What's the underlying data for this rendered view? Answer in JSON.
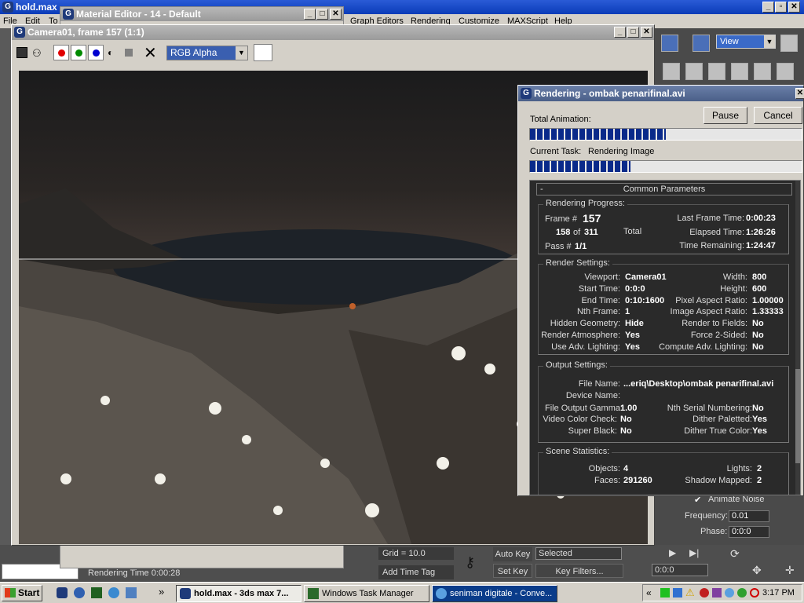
{
  "desktop": {
    "max_title": "hold.max",
    "menu_items": [
      "File",
      "Edit",
      "To",
      "Graph Editors",
      "Rendering",
      "Customize",
      "MAXScript",
      "Help"
    ],
    "view_select": "View"
  },
  "material_editor": {
    "title": "Material Editor - 14 - Default"
  },
  "frame_window": {
    "title": "Camera01, frame 157 (1:1)",
    "channel_select": "RGB Alpha"
  },
  "rendering_dialog": {
    "title": "Rendering - ombak penarifinal.avi",
    "pause_label": "Pause",
    "cancel_label": "Cancel",
    "total_animation_label": "Total Animation:",
    "total_progress": 0.5,
    "current_task_label": "Current Task:",
    "current_task_value": "Rendering Image",
    "task_progress": 0.37,
    "rollout_toggle": "-",
    "rollout_title": "Common Parameters",
    "progress": {
      "title": "Rendering Progress:",
      "frame_label": "Frame #",
      "frame_value": "157",
      "frames_done": "158",
      "of_label": "of",
      "frames_total": "311",
      "total_label": "Total",
      "pass_label": "Pass #",
      "pass_value": "1/1",
      "last_frame_label": "Last Frame Time:",
      "last_frame_value": "0:00:23",
      "elapsed_label": "Elapsed Time:",
      "elapsed_value": "1:26:26",
      "remaining_label": "Time Remaining:",
      "remaining_value": "1:24:47"
    },
    "render_settings": {
      "title": "Render Settings:",
      "left": [
        {
          "label": "Viewport:",
          "value": "Camera01"
        },
        {
          "label": "Start Time:",
          "value": "0:0:0"
        },
        {
          "label": "End Time:",
          "value": "0:10:1600"
        },
        {
          "label": "Nth Frame:",
          "value": "1"
        },
        {
          "label": "Hidden Geometry:",
          "value": "Hide"
        },
        {
          "label": "Render Atmosphere:",
          "value": "Yes"
        },
        {
          "label": "Use Adv. Lighting:",
          "value": "Yes"
        }
      ],
      "right": [
        {
          "label": "Width:",
          "value": "800"
        },
        {
          "label": "Height:",
          "value": "600"
        },
        {
          "label": "Pixel Aspect Ratio:",
          "value": "1.00000"
        },
        {
          "label": "Image Aspect Ratio:",
          "value": "1.33333"
        },
        {
          "label": "Render to Fields:",
          "value": "No"
        },
        {
          "label": "Force 2-Sided:",
          "value": "No"
        },
        {
          "label": "Compute Adv. Lighting:",
          "value": "No"
        }
      ]
    },
    "output_settings": {
      "title": "Output Settings:",
      "file_name_label": "File Name:",
      "file_name_value": "...eriq\\Desktop\\ombak penarifinal.avi",
      "device_name_label": "Device Name:",
      "gamma_label": "File Output Gamma:",
      "gamma_value": "1.00",
      "nth_serial_label": "Nth Serial Numbering:",
      "nth_serial_value": "No",
      "video_check_label": "Video Color Check:",
      "video_check_value": "No",
      "dither_pal_label": "Dither Paletted:",
      "dither_pal_value": "Yes",
      "super_black_label": "Super Black:",
      "super_black_value": "No",
      "dither_true_label": "Dither True Color:",
      "dither_true_value": "Yes"
    },
    "scene_stats": {
      "title": "Scene Statistics:",
      "objects_label": "Objects:",
      "objects_value": "4",
      "lights_label": "Lights:",
      "lights_value": "2",
      "faces_label": "Faces:",
      "faces_value": "291260",
      "shadow_label": "Shadow Mapped:",
      "shadow_value": "2"
    }
  },
  "side_panel": {
    "animate_noise_label": "Animate Noise",
    "frequency_label": "Frequency:",
    "frequency_value": "0.01",
    "phase_label": "Phase:",
    "phase_value": "0:0:0"
  },
  "status_bar": {
    "grid_label": "Grid = 10.0",
    "rendering_time": "Rendering Time  0:00:28",
    "add_time_tag": "Add Time Tag",
    "auto_key": "Auto Key",
    "set_key": "Set Key",
    "selected": "Selected",
    "key_filters": "Key Filters...",
    "time_value": "0:0:0"
  },
  "taskbar": {
    "start_label": "Start",
    "chevron": "»",
    "tasks": [
      {
        "label": "hold.max - 3ds max 7..."
      },
      {
        "label": "Windows Task Manager"
      },
      {
        "label": "seniman digitale - Conve..."
      }
    ],
    "clock": "3:17 PM",
    "tray_chevron": "«"
  }
}
